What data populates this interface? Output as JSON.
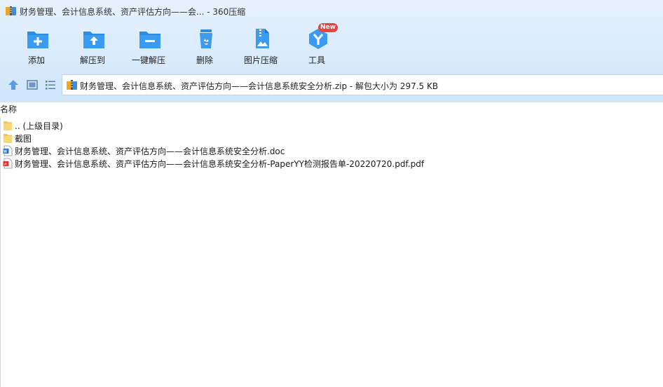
{
  "window": {
    "title": "财务管理、会计信息系统、资产评估方向——会... - 360压缩"
  },
  "toolbar": {
    "add": "添加",
    "extract_to": "解压到",
    "one_click_extract": "一键解压",
    "delete": "删除",
    "image_compress": "图片压缩",
    "tools": "工具",
    "tools_badge": "New"
  },
  "path": {
    "text": "财务管理、会计信息系统、资产评估方向——会计信息系统安全分析.zip - 解包大小为 297.5 KB"
  },
  "list": {
    "column_name": "名称",
    "items": [
      {
        "name": ".. (上级目录)",
        "type": "folder"
      },
      {
        "name": "截图",
        "type": "folder"
      },
      {
        "name": "财务管理、会计信息系统、资产评估方向——会计信息系统安全分析.doc",
        "type": "doc"
      },
      {
        "name": "财务管理、会计信息系统、资产评估方向——会计信息系统安全分析-PaperYY检测报告单-20220720.pdf.pdf",
        "type": "pdf"
      }
    ]
  },
  "colors": {
    "accent": "#2b8ce0",
    "badge": "#e8433c",
    "header_bg": "#d8eafb"
  }
}
